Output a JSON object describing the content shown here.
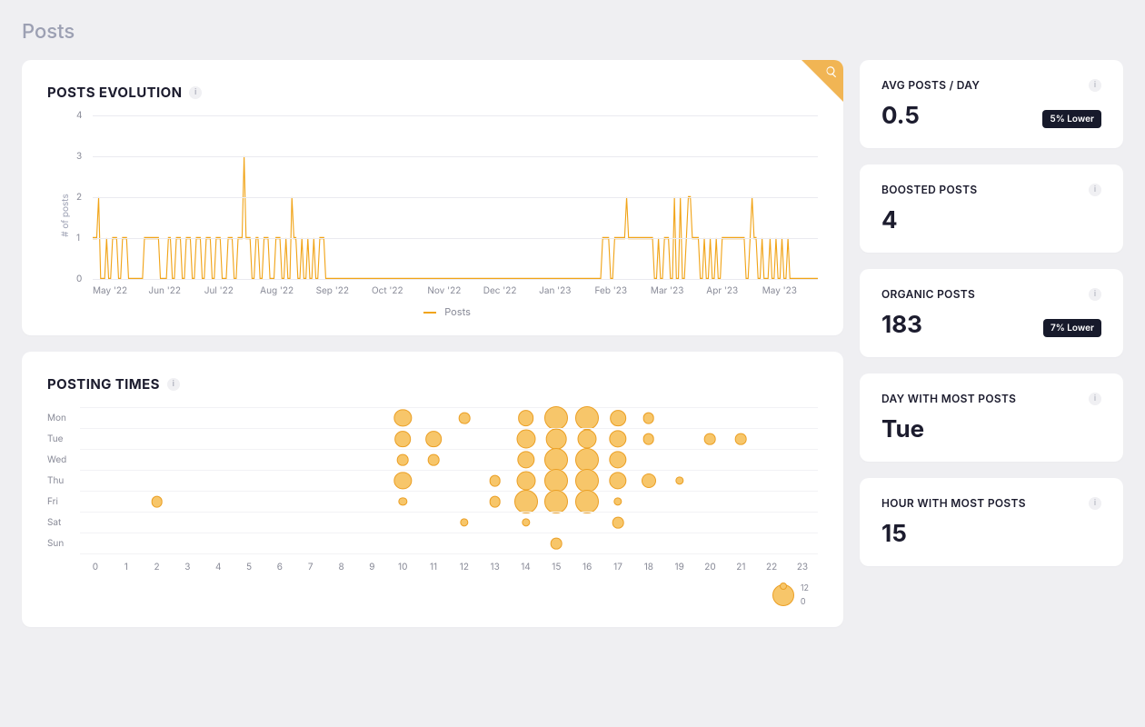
{
  "page": {
    "title": "Posts"
  },
  "chart_data": [
    {
      "id": "posts_evolution",
      "type": "line",
      "title": "POSTS EVOLUTION",
      "ylabel": "# of posts",
      "ylim": [
        0,
        4
      ],
      "yticks": [
        0,
        1,
        2,
        3,
        4
      ],
      "x_tick_labels": [
        "May '22",
        "Jun '22",
        "Jul '22",
        "Aug '22",
        "Sep '22",
        "Oct '22",
        "Nov '22",
        "Dec '22",
        "Jan '23",
        "Feb '23",
        "Mar '23",
        "Apr '23",
        "May '23"
      ],
      "legend": {
        "label": "Posts",
        "color": "#f1a418"
      },
      "series": [
        {
          "name": "Posts",
          "values": [
            1,
            1,
            1,
            2,
            0,
            0,
            0,
            1,
            0,
            0,
            1,
            1,
            1,
            0,
            0,
            1,
            1,
            1,
            0,
            0,
            0,
            0,
            0,
            0,
            0,
            0,
            1,
            1,
            1,
            1,
            1,
            1,
            1,
            1,
            0,
            0,
            0,
            0,
            1,
            1,
            0,
            0,
            1,
            1,
            1,
            0,
            0,
            1,
            1,
            1,
            0,
            0,
            1,
            1,
            1,
            0,
            0,
            1,
            1,
            1,
            0,
            0,
            1,
            1,
            1,
            0,
            0,
            0,
            1,
            1,
            1,
            0,
            0,
            1,
            1,
            1,
            3,
            1,
            1,
            1,
            0,
            0,
            1,
            1,
            0,
            0,
            1,
            1,
            1,
            0,
            0,
            0,
            1,
            1,
            1,
            0,
            0,
            1,
            0,
            0,
            2,
            1,
            1,
            0,
            0,
            1,
            0,
            0,
            1,
            0,
            0,
            1,
            0,
            0,
            1,
            1,
            1,
            0,
            0,
            0,
            0,
            0,
            0,
            0,
            0,
            0,
            0,
            0,
            0,
            0,
            0,
            0,
            0,
            0,
            0,
            0,
            0,
            0,
            0,
            0,
            0,
            0,
            0,
            0,
            0,
            0,
            0,
            0,
            0,
            0,
            0,
            0,
            0,
            0,
            0,
            0,
            0,
            0,
            0,
            0,
            0,
            0,
            0,
            0,
            0,
            0,
            0,
            0,
            0,
            0,
            0,
            0,
            0,
            0,
            0,
            0,
            0,
            0,
            0,
            0,
            0,
            0,
            0,
            0,
            0,
            0,
            0,
            0,
            0,
            0,
            0,
            0,
            0,
            0,
            0,
            0,
            0,
            0,
            0,
            0,
            0,
            0,
            0,
            0,
            0,
            0,
            0,
            0,
            0,
            0,
            0,
            0,
            0,
            0,
            0,
            0,
            0,
            0,
            0,
            0,
            0,
            0,
            0,
            0,
            0,
            0,
            0,
            0,
            0,
            0,
            0,
            0,
            0,
            0,
            0,
            0,
            0,
            0,
            0,
            0,
            0,
            0,
            0,
            0,
            0,
            0,
            0,
            0,
            0,
            0,
            0,
            0,
            0,
            0,
            0,
            0,
            1,
            1,
            1,
            1,
            0,
            0,
            1,
            1,
            1,
            1,
            1,
            1,
            2,
            1,
            1,
            1,
            1,
            1,
            1,
            1,
            1,
            1,
            1,
            1,
            1,
            1,
            0,
            0,
            1,
            0,
            0,
            1,
            1,
            1,
            0,
            0,
            2,
            0,
            0,
            2,
            0,
            0,
            1,
            2,
            2,
            1,
            1,
            1,
            1,
            0,
            0,
            1,
            0,
            0,
            1,
            0,
            0,
            1,
            0,
            0,
            1,
            1,
            1,
            1,
            1,
            1,
            1,
            1,
            1,
            1,
            1,
            1,
            0,
            0,
            1,
            2,
            1,
            1,
            0,
            0,
            1,
            0,
            0,
            0,
            1,
            0,
            0,
            1,
            0,
            0,
            1,
            0,
            0,
            1,
            0,
            0,
            0,
            0,
            0,
            0,
            0,
            0,
            0,
            0,
            0,
            0,
            0,
            0,
            0
          ]
        }
      ]
    },
    {
      "id": "posting_times",
      "type": "bubble",
      "title": "POSTING TIMES",
      "y_categories": [
        "Mon",
        "Tue",
        "Wed",
        "Thu",
        "Fri",
        "Sat",
        "Sun"
      ],
      "x_categories": [
        0,
        1,
        2,
        3,
        4,
        5,
        6,
        7,
        8,
        9,
        10,
        11,
        12,
        13,
        14,
        15,
        16,
        17,
        18,
        19,
        20,
        21,
        22,
        23
      ],
      "legend": {
        "min": 0.0,
        "max": 12.0
      },
      "points": [
        {
          "day": "Mon",
          "hour": 10,
          "count": 8
        },
        {
          "day": "Mon",
          "hour": 12,
          "count": 4
        },
        {
          "day": "Mon",
          "hour": 14,
          "count": 7
        },
        {
          "day": "Mon",
          "hour": 15,
          "count": 12
        },
        {
          "day": "Mon",
          "hour": 16,
          "count": 12
        },
        {
          "day": "Mon",
          "hour": 17,
          "count": 7
        },
        {
          "day": "Mon",
          "hour": 18,
          "count": 4
        },
        {
          "day": "Tue",
          "hour": 10,
          "count": 7
        },
        {
          "day": "Tue",
          "hour": 11,
          "count": 7
        },
        {
          "day": "Tue",
          "hour": 14,
          "count": 9
        },
        {
          "day": "Tue",
          "hour": 15,
          "count": 10
        },
        {
          "day": "Tue",
          "hour": 16,
          "count": 9
        },
        {
          "day": "Tue",
          "hour": 17,
          "count": 8
        },
        {
          "day": "Tue",
          "hour": 18,
          "count": 4
        },
        {
          "day": "Tue",
          "hour": 20,
          "count": 4
        },
        {
          "day": "Tue",
          "hour": 21,
          "count": 4
        },
        {
          "day": "Wed",
          "hour": 10,
          "count": 4
        },
        {
          "day": "Wed",
          "hour": 11,
          "count": 4
        },
        {
          "day": "Wed",
          "hour": 14,
          "count": 8
        },
        {
          "day": "Wed",
          "hour": 15,
          "count": 12
        },
        {
          "day": "Wed",
          "hour": 16,
          "count": 12
        },
        {
          "day": "Wed",
          "hour": 17,
          "count": 8
        },
        {
          "day": "Thu",
          "hour": 10,
          "count": 8
        },
        {
          "day": "Thu",
          "hour": 13,
          "count": 4
        },
        {
          "day": "Thu",
          "hour": 14,
          "count": 9
        },
        {
          "day": "Thu",
          "hour": 15,
          "count": 12
        },
        {
          "day": "Thu",
          "hour": 16,
          "count": 12
        },
        {
          "day": "Thu",
          "hour": 17,
          "count": 8
        },
        {
          "day": "Thu",
          "hour": 18,
          "count": 6
        },
        {
          "day": "Thu",
          "hour": 19,
          "count": 2
        },
        {
          "day": "Fri",
          "hour": 2,
          "count": 4
        },
        {
          "day": "Fri",
          "hour": 10,
          "count": 2
        },
        {
          "day": "Fri",
          "hour": 13,
          "count": 4
        },
        {
          "day": "Fri",
          "hour": 14,
          "count": 12
        },
        {
          "day": "Fri",
          "hour": 15,
          "count": 12
        },
        {
          "day": "Fri",
          "hour": 16,
          "count": 12
        },
        {
          "day": "Fri",
          "hour": 17,
          "count": 2
        },
        {
          "day": "Sat",
          "hour": 12,
          "count": 2
        },
        {
          "day": "Sat",
          "hour": 14,
          "count": 2
        },
        {
          "day": "Sat",
          "hour": 17,
          "count": 4
        },
        {
          "day": "Sun",
          "hour": 15,
          "count": 4
        }
      ]
    }
  ],
  "stats": [
    {
      "id": "avg",
      "title": "AVG POSTS / DAY",
      "value": "0.5",
      "badge": "5% Lower"
    },
    {
      "id": "boost",
      "title": "BOOSTED POSTS",
      "value": "4",
      "badge": ""
    },
    {
      "id": "org",
      "title": "ORGANIC POSTS",
      "value": "183",
      "badge": "7% Lower"
    },
    {
      "id": "day",
      "title": "DAY WITH MOST POSTS",
      "value": "Tue",
      "badge": ""
    },
    {
      "id": "hour",
      "title": "HOUR WITH MOST POSTS",
      "value": "15",
      "badge": ""
    }
  ],
  "icons": {
    "info": "i",
    "search": "search"
  }
}
